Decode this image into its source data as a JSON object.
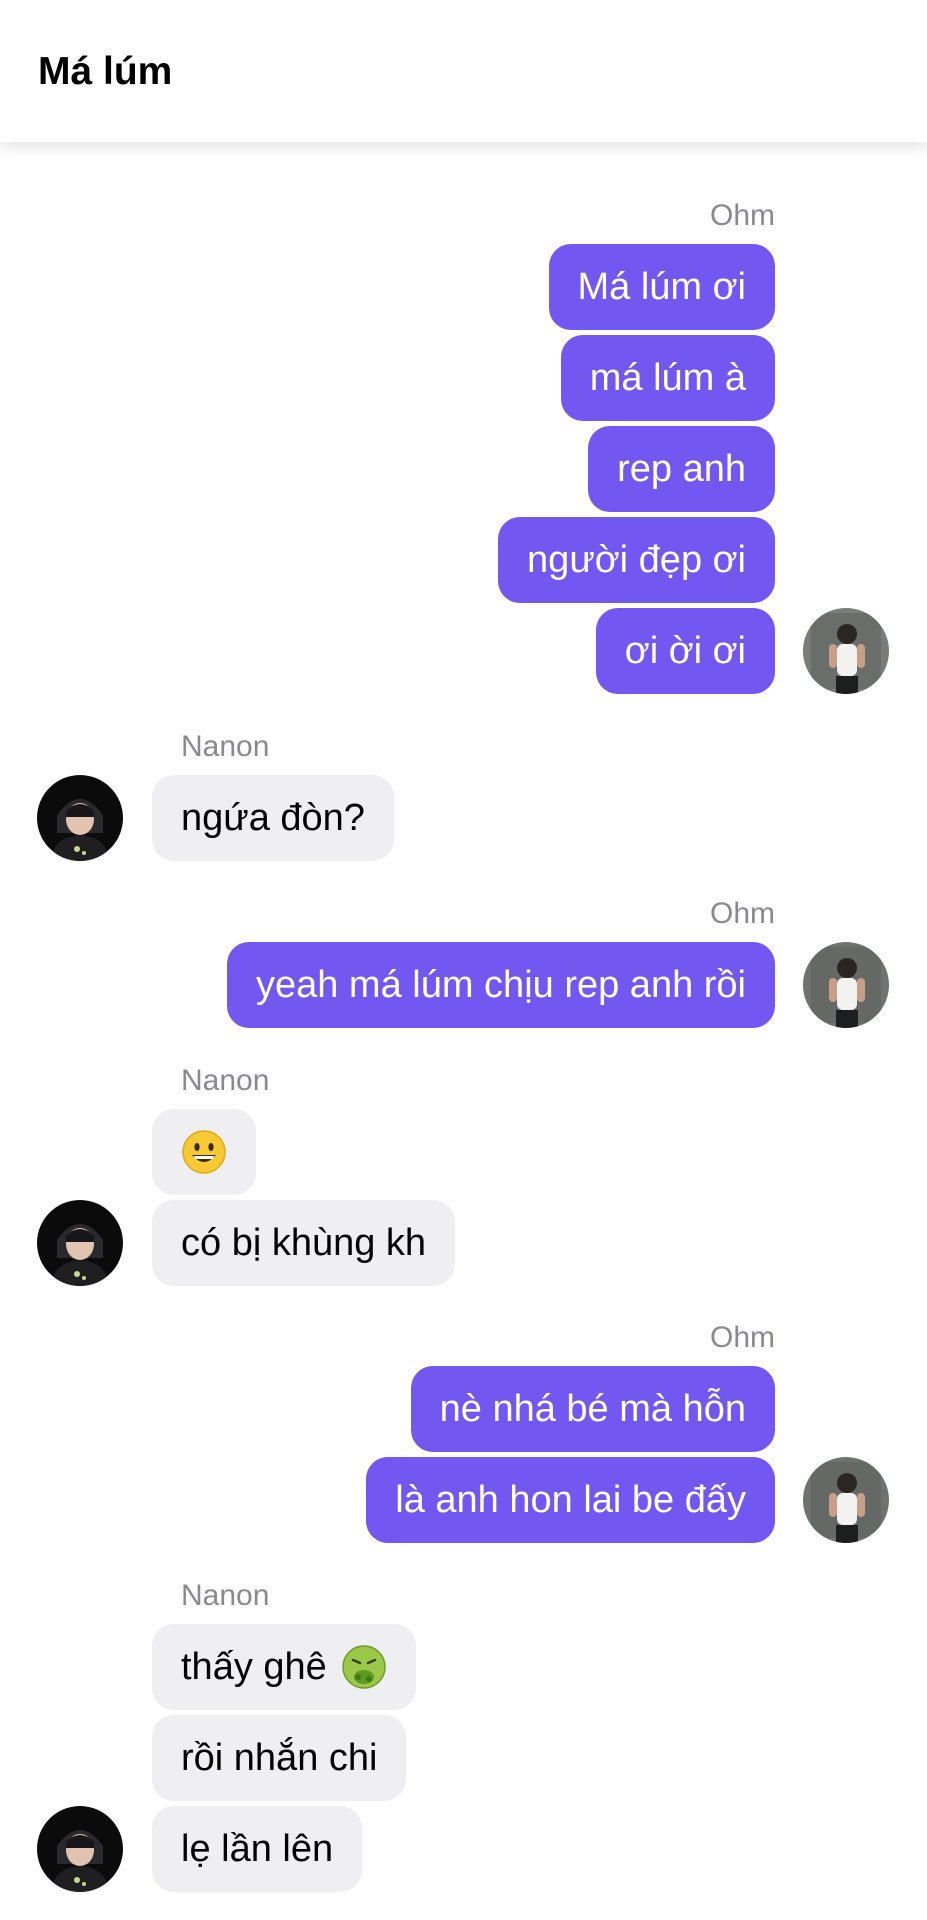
{
  "header": {
    "title": "Má lúm"
  },
  "chat": {
    "senders": {
      "ohm": "Ohm",
      "nanon": "Nanon"
    },
    "groups": [
      {
        "sender": "Ohm",
        "direction": "outgoing",
        "messages": [
          "Má lúm ơi",
          "má lúm à",
          "rep anh",
          "người đẹp ơi",
          "ơi ời ơi"
        ]
      },
      {
        "sender": "Nanon",
        "direction": "incoming",
        "messages": [
          "ngứa đòn?"
        ]
      },
      {
        "sender": "Ohm",
        "direction": "outgoing",
        "messages": [
          "yeah má lúm chịu rep anh rồi"
        ]
      },
      {
        "sender": "Nanon",
        "direction": "incoming",
        "messages": [
          "grinning-face-emoji",
          "có bị khùng kh"
        ]
      },
      {
        "sender": "Ohm",
        "direction": "outgoing",
        "messages": [
          "nè nhá bé mà hỗn",
          "là anh hon lai be đấy"
        ]
      },
      {
        "sender": "Nanon",
        "direction": "incoming",
        "messages": [
          "thấy ghê",
          "rồi nhắn chi",
          "lẹ lần lên"
        ]
      }
    ]
  },
  "colors": {
    "outgoing_bubble": "#7257f0",
    "incoming_bubble": "#efeff1",
    "sender_label": "#8a8a8e"
  },
  "icons": {
    "emoji_1": "grinning-face-emoji",
    "emoji_2": "nauseated-face-emoji",
    "avatar_ohm": "avatar-photo",
    "avatar_nanon": "avatar-photo"
  }
}
